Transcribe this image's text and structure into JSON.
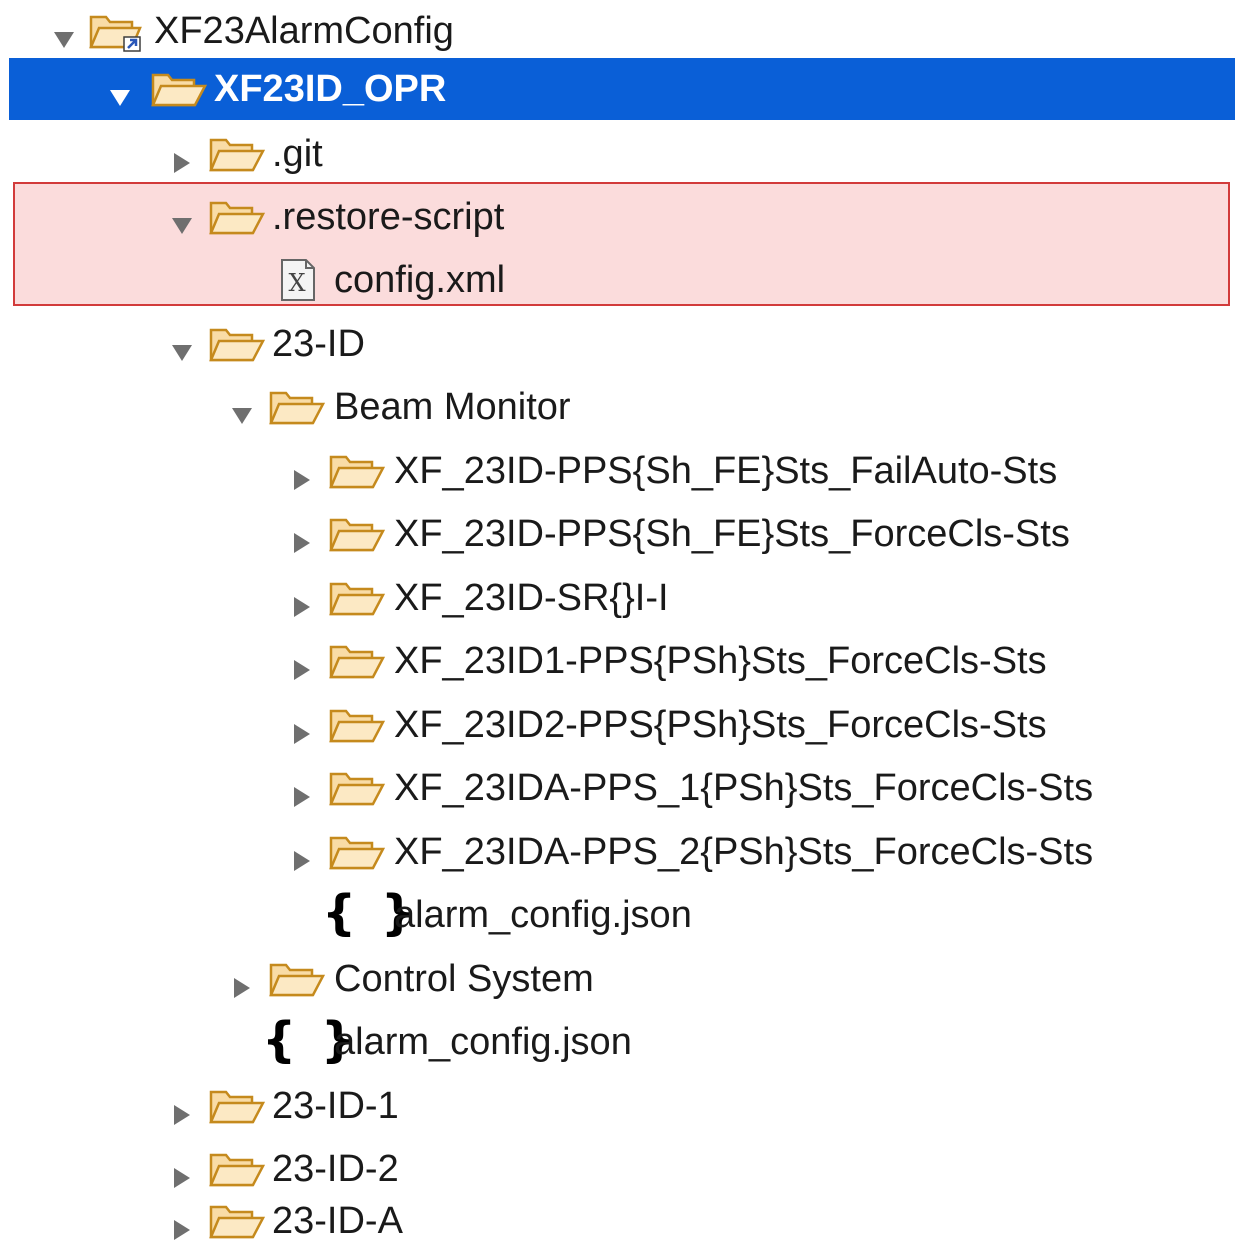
{
  "project": {
    "label": "XF23AlarmConfig",
    "icon": "project-folder-icon",
    "expanded": true
  },
  "nodes": [
    {
      "id": "opr",
      "label": "XF23ID_OPR",
      "icon": "open-folder-icon",
      "expanded": true,
      "selected": true
    },
    {
      "id": "git",
      "label": ".git",
      "icon": "open-folder-icon",
      "expanded": false
    },
    {
      "id": "restore",
      "label": ".restore-script",
      "icon": "open-folder-icon",
      "expanded": true
    },
    {
      "id": "config",
      "label": "config.xml",
      "icon": "xml-file-icon"
    },
    {
      "id": "id23",
      "label": "23-ID",
      "icon": "open-folder-icon",
      "expanded": true
    },
    {
      "id": "beam",
      "label": "Beam Monitor",
      "icon": "open-folder-icon",
      "expanded": true
    },
    {
      "id": "pv1",
      "label": "XF_23ID-PPS{Sh_FE}Sts_FailAuto-Sts",
      "icon": "open-folder-icon",
      "expanded": false
    },
    {
      "id": "pv2",
      "label": "XF_23ID-PPS{Sh_FE}Sts_ForceCls-Sts",
      "icon": "open-folder-icon",
      "expanded": false
    },
    {
      "id": "pv3",
      "label": "XF_23ID-SR{}I-I",
      "icon": "open-folder-icon",
      "expanded": false
    },
    {
      "id": "pv4",
      "label": "XF_23ID1-PPS{PSh}Sts_ForceCls-Sts",
      "icon": "open-folder-icon",
      "expanded": false
    },
    {
      "id": "pv5",
      "label": "XF_23ID2-PPS{PSh}Sts_ForceCls-Sts",
      "icon": "open-folder-icon",
      "expanded": false
    },
    {
      "id": "pv6",
      "label": "XF_23IDA-PPS_1{PSh}Sts_ForceCls-Sts",
      "icon": "open-folder-icon",
      "expanded": false
    },
    {
      "id": "pv7",
      "label": "XF_23IDA-PPS_2{PSh}Sts_ForceCls-Sts",
      "icon": "open-folder-icon",
      "expanded": false
    },
    {
      "id": "beamjson",
      "label": "alarm_config.json",
      "icon": "json-file-icon"
    },
    {
      "id": "control",
      "label": "Control System",
      "icon": "open-folder-icon",
      "expanded": false
    },
    {
      "id": "idjson",
      "label": "alarm_config.json",
      "icon": "json-file-icon"
    },
    {
      "id": "id231",
      "label": "23-ID-1",
      "icon": "open-folder-icon",
      "expanded": false
    },
    {
      "id": "id232",
      "label": "23-ID-2",
      "icon": "open-folder-icon",
      "expanded": false
    },
    {
      "id": "id23a",
      "label": "23-ID-A",
      "icon": "open-folder-icon",
      "expanded": false
    }
  ],
  "json_icon_glyph": "{ }",
  "colors": {
    "selection": "#0a5fd7",
    "highlight_fill": "#fbdcdc",
    "highlight_border": "#d23b3b",
    "folder_fill": "#f9dca6",
    "folder_stroke": "#c58a1d",
    "toggle": "#6f6f6f"
  }
}
